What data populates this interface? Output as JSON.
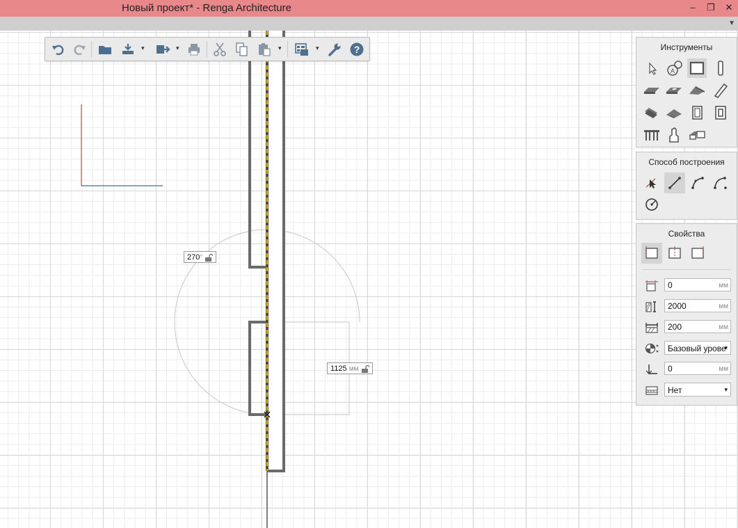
{
  "window": {
    "title": "Новый проект* - Renga Architecture",
    "minimize_glyph": "–",
    "maximize_glyph": "❐",
    "close_glyph": "✕"
  },
  "ribbon": {
    "expand_glyph": "▼"
  },
  "toolbar": {
    "buttons": [
      "undo-icon",
      "redo-icon",
      "open-folder-icon",
      "import-icon",
      "export-icon",
      "print-icon",
      "cut-icon",
      "copy-icon",
      "paste-icon",
      "views-icon",
      "settings-wrench-icon",
      "help-icon"
    ],
    "dropdown_glyph": "▾"
  },
  "tools_panel": {
    "title": "Инструменты",
    "items": [
      "select-arrow-icon",
      "axis-grid-icon",
      "wall-icon",
      "column-icon",
      "floor-icon",
      "opening-icon",
      "roof-icon",
      "beam-icon",
      "stair-icon",
      "ramp-icon",
      "door-icon",
      "window-icon",
      "railing-icon",
      "equipment-icon",
      "room-icon"
    ],
    "selected": "wall-icon"
  },
  "construction_panel": {
    "title": "Способ построения",
    "items": [
      "point-construct-icon",
      "line-construct-icon",
      "arc-three-point-icon",
      "arc-center-icon",
      "circle-construct-icon"
    ],
    "selected": "line-construct-icon"
  },
  "properties_panel": {
    "title": "Свойства",
    "alignment_items": [
      "align-left-icon",
      "align-center-icon",
      "align-right-icon"
    ],
    "alignment_selected": "align-left-icon",
    "offset": {
      "value": "0",
      "unit": "мм"
    },
    "height": {
      "value": "2000",
      "unit": "мм"
    },
    "thickness": {
      "value": "200",
      "unit": "мм"
    },
    "level": {
      "value": "Базовый урове",
      "arrow": "▾"
    },
    "elevation": {
      "value": "0",
      "unit": "мм"
    },
    "material": {
      "value": "Нет",
      "arrow": "▾"
    }
  },
  "canvas": {
    "angle_dim": {
      "value": "270",
      "unit": "°"
    },
    "length_dim": {
      "value": "1125",
      "unit": "мм"
    },
    "colors": {
      "wall": "#6a6a6a",
      "axis_dash": "#e0b800",
      "guide": "#cfcfcf",
      "x_axis": "#3e6f9a",
      "y_axis": "#c0504d"
    }
  }
}
